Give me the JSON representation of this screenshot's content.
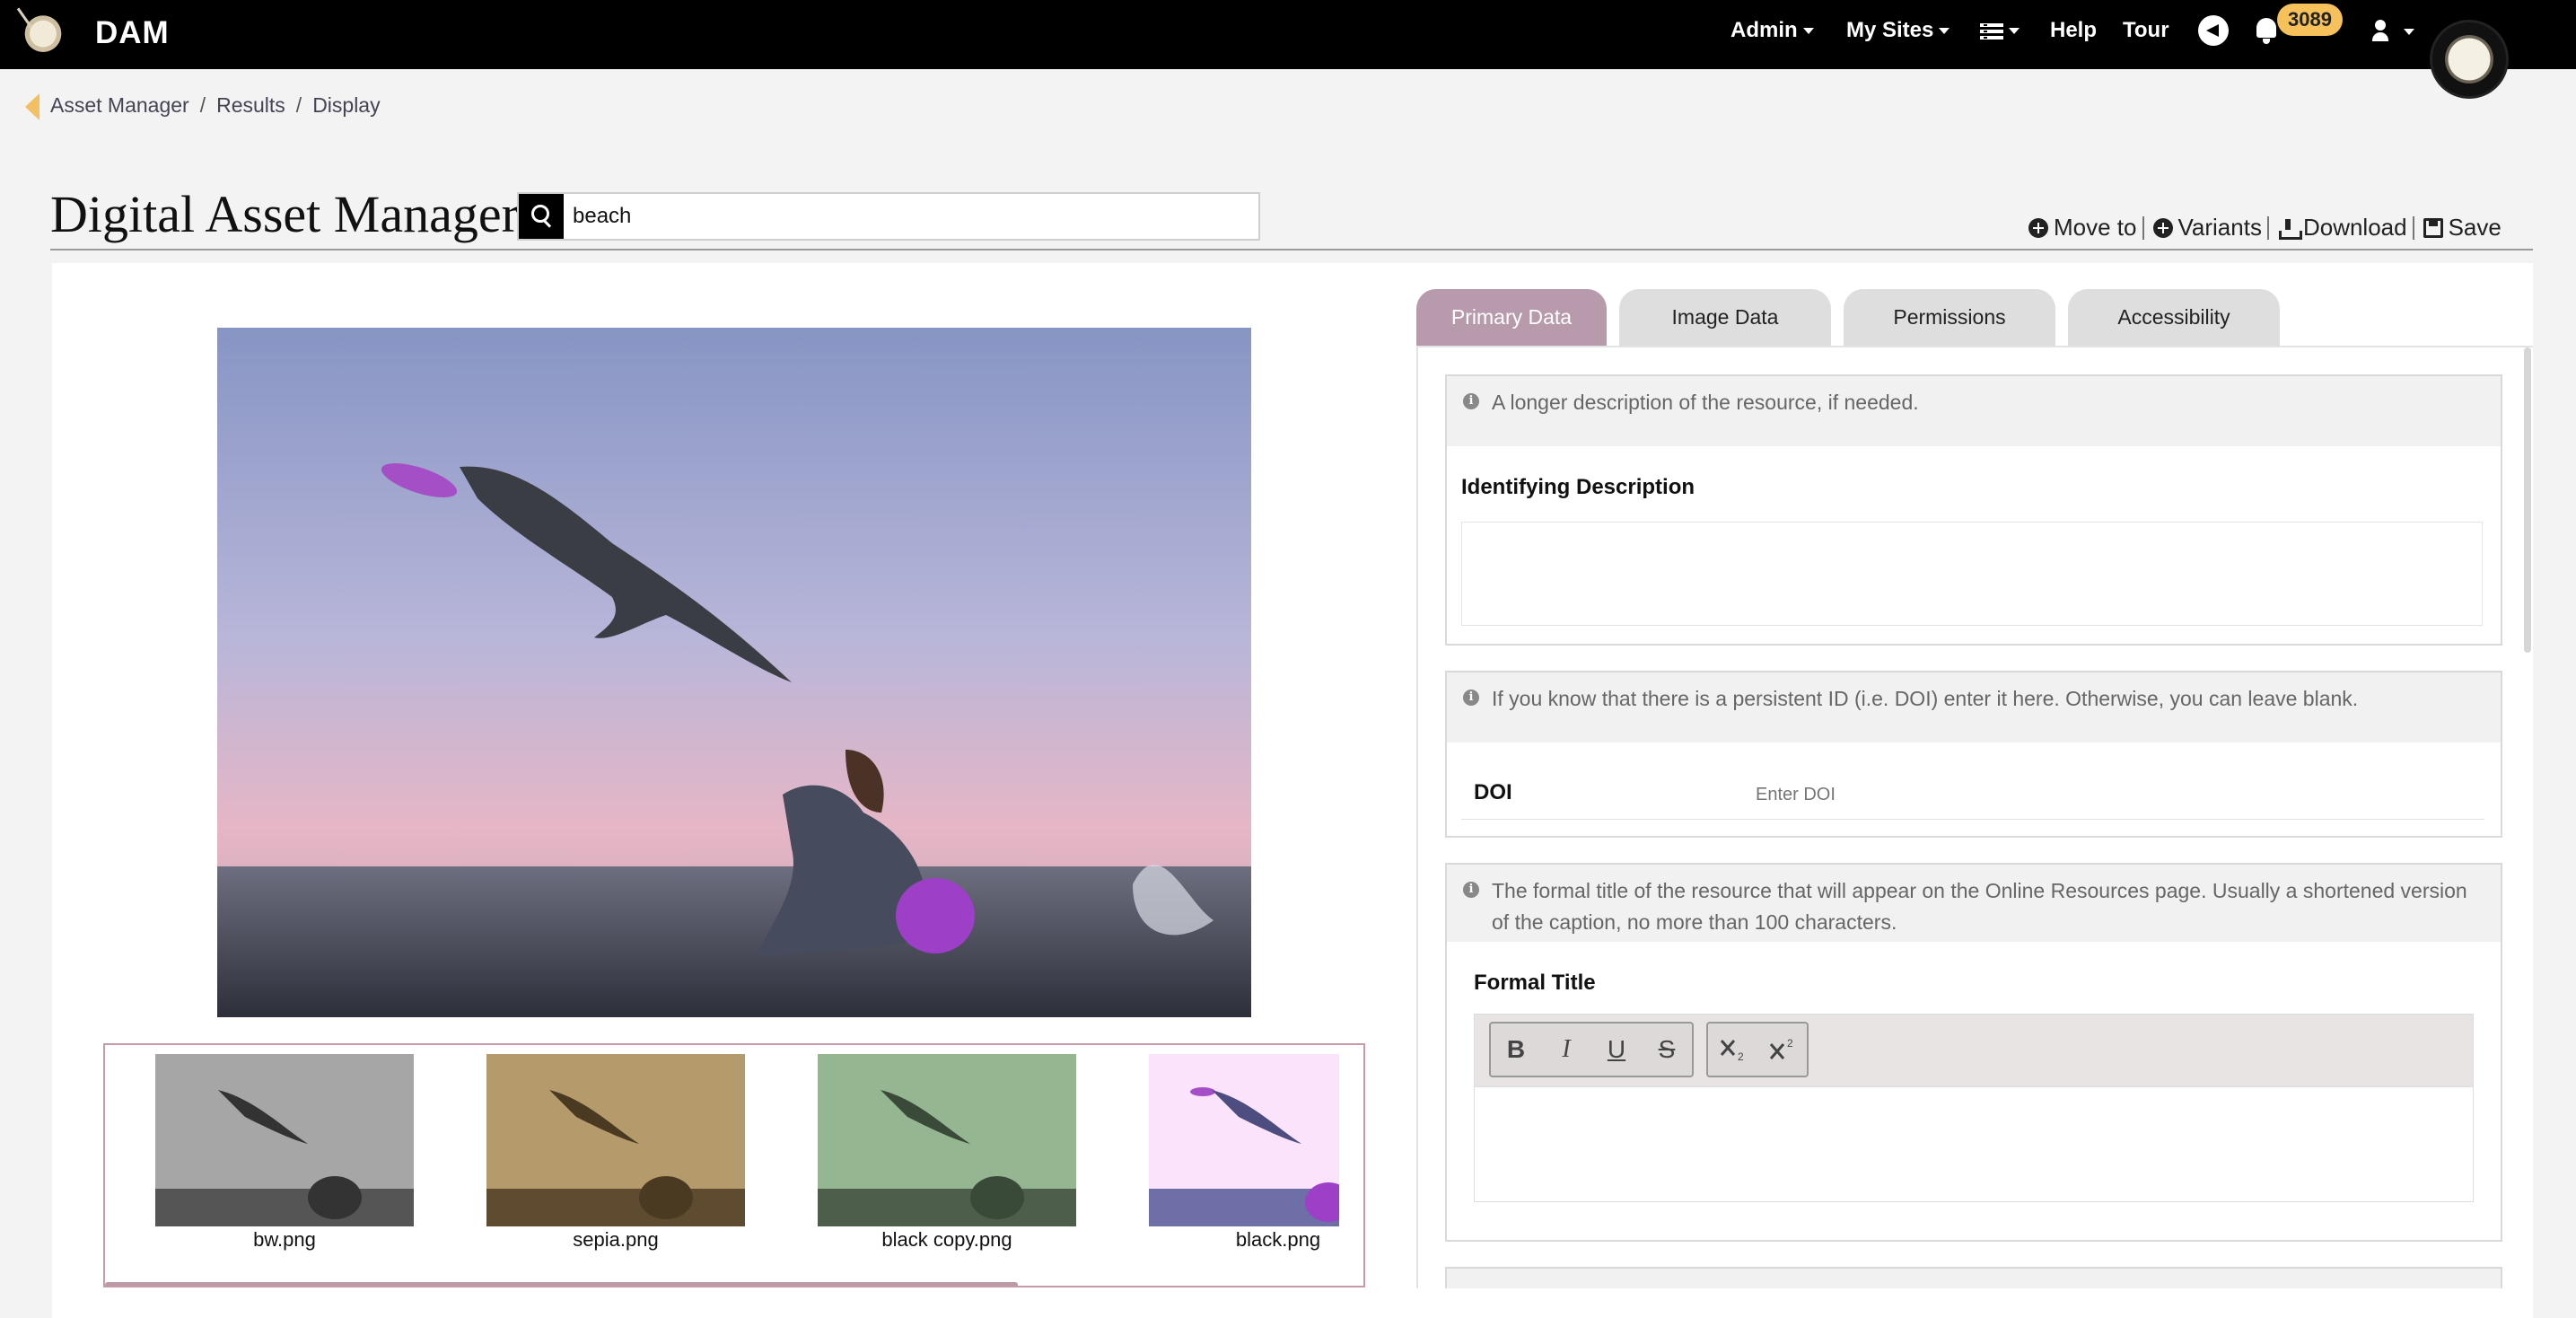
{
  "app": {
    "brand": "DAM"
  },
  "nav": {
    "admin": "Admin",
    "my_sites": "My Sites",
    "help": "Help",
    "tour": "Tour",
    "notifications_count": "3089"
  },
  "breadcrumb": {
    "items": [
      "Asset Manager",
      "Results",
      "Display"
    ]
  },
  "page": {
    "title": "Digital Asset Manager"
  },
  "search": {
    "value": "beach"
  },
  "actions": {
    "move_to": "Move to",
    "variants": "Variants",
    "download": "Download",
    "save": "Save"
  },
  "thumbnails": [
    {
      "label": "bw.png",
      "filter": "grayscale"
    },
    {
      "label": "sepia.png",
      "filter": "sepia"
    },
    {
      "label": "black copy.png",
      "filter": "green"
    },
    {
      "label": "black.png",
      "filter": "bright"
    }
  ],
  "tabs": [
    "Primary Data",
    "Image Data",
    "Permissions",
    "Accessibility"
  ],
  "primary_data": {
    "description": {
      "hint": "A longer description of the resource, if needed.",
      "label": "Identifying Description"
    },
    "doi": {
      "hint": "If you know that there is a persistent ID (i.e. DOI) enter it here. Otherwise, you can leave blank.",
      "label": "DOI",
      "placeholder": "Enter DOI"
    },
    "formal_title": {
      "hint": "The formal title of the resource that will appear on the Online Resources page. Usually a shortened version of the caption, no more than 100 characters.",
      "label": "Formal Title",
      "toolbar": {
        "bold": "B",
        "italic": "I",
        "underline": "U",
        "strike": "S"
      }
    }
  },
  "colors": {
    "tab_active": "#b79aab",
    "badge": "#f6c15a",
    "breadcrumb_arrow": "#f3bf63"
  }
}
